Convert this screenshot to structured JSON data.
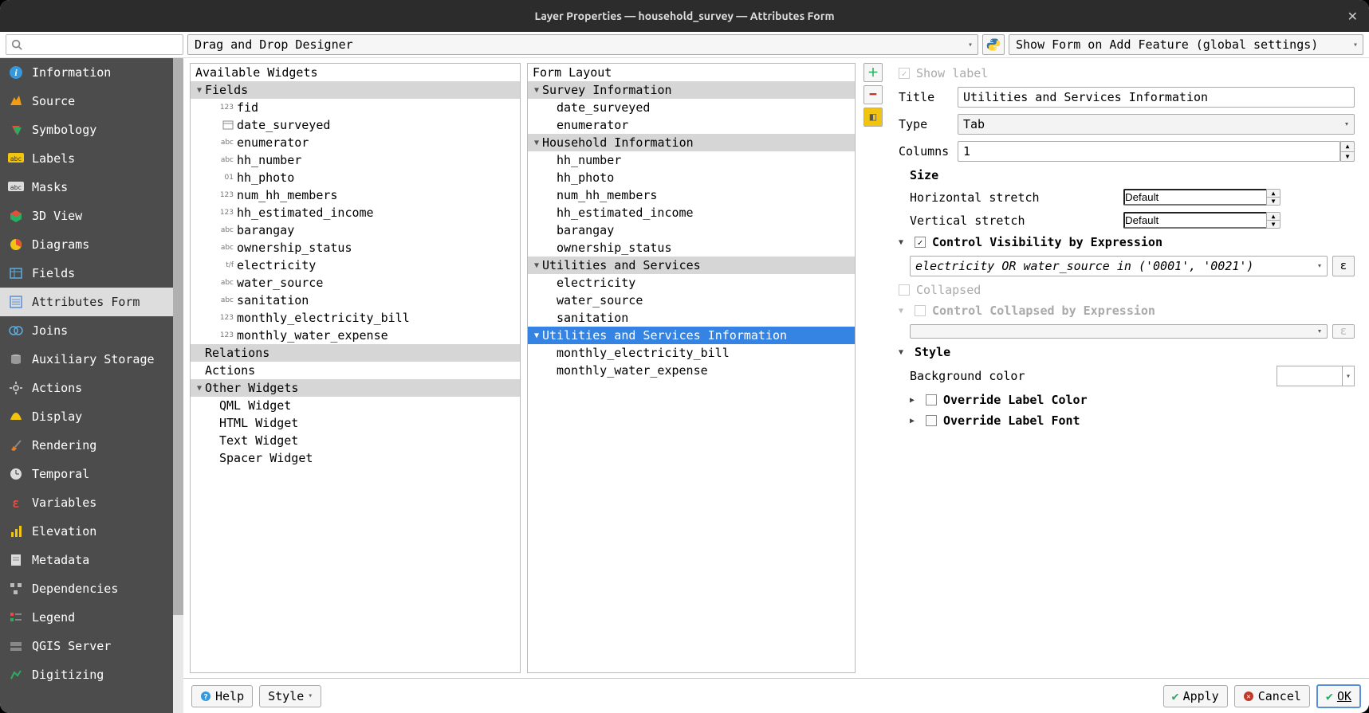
{
  "window": {
    "title": "Layer Properties — household_survey — Attributes Form"
  },
  "topbar": {
    "designer": "Drag and Drop Designer",
    "show_form": "Show Form on Add Feature (global settings)"
  },
  "sidebar": {
    "items": [
      {
        "label": "Information"
      },
      {
        "label": "Source"
      },
      {
        "label": "Symbology"
      },
      {
        "label": "Labels"
      },
      {
        "label": "Masks"
      },
      {
        "label": "3D View"
      },
      {
        "label": "Diagrams"
      },
      {
        "label": "Fields"
      },
      {
        "label": "Attributes Form"
      },
      {
        "label": "Joins"
      },
      {
        "label": "Auxiliary Storage"
      },
      {
        "label": "Actions"
      },
      {
        "label": "Display"
      },
      {
        "label": "Rendering"
      },
      {
        "label": "Temporal"
      },
      {
        "label": "Variables"
      },
      {
        "label": "Elevation"
      },
      {
        "label": "Metadata"
      },
      {
        "label": "Dependencies"
      },
      {
        "label": "Legend"
      },
      {
        "label": "QGIS Server"
      },
      {
        "label": "Digitizing"
      }
    ]
  },
  "available": {
    "header": "Available Widgets",
    "fields_group": "Fields",
    "fields": [
      {
        "icon": "123",
        "name": "fid"
      },
      {
        "icon": "date",
        "name": "date_surveyed"
      },
      {
        "icon": "abc",
        "name": "enumerator"
      },
      {
        "icon": "abc",
        "name": "hh_number"
      },
      {
        "icon": "01",
        "name": "hh_photo"
      },
      {
        "icon": "123",
        "name": "num_hh_members"
      },
      {
        "icon": "123",
        "name": "hh_estimated_income"
      },
      {
        "icon": "abc",
        "name": "barangay"
      },
      {
        "icon": "abc",
        "name": "ownership_status"
      },
      {
        "icon": "t/f",
        "name": "electricity"
      },
      {
        "icon": "abc",
        "name": "water_source"
      },
      {
        "icon": "abc",
        "name": "sanitation"
      },
      {
        "icon": "123",
        "name": "monthly_electricity_bill"
      },
      {
        "icon": "123",
        "name": "monthly_water_expense"
      }
    ],
    "relations_group": "Relations",
    "actions_group": "Actions",
    "other_group": "Other Widgets",
    "other": [
      "QML Widget",
      "HTML Widget",
      "Text Widget",
      "Spacer Widget"
    ]
  },
  "layout": {
    "header": "Form Layout",
    "groups": [
      {
        "name": "Survey Information",
        "children": [
          "date_surveyed",
          "enumerator"
        ]
      },
      {
        "name": "Household Information",
        "children": [
          "hh_number",
          "hh_photo",
          "num_hh_members",
          "hh_estimated_income",
          "barangay",
          "ownership_status"
        ]
      },
      {
        "name": "Utilities and Services",
        "children": [
          "electricity",
          "water_source",
          "sanitation"
        ]
      },
      {
        "name": "Utilities and Services Information",
        "selected": true,
        "children": [
          "monthly_electricity_bill",
          "monthly_water_expense"
        ]
      }
    ]
  },
  "props": {
    "show_label": "Show label",
    "title_label": "Title",
    "title_value": "Utilities and Services Information",
    "type_label": "Type",
    "type_value": "Tab",
    "columns_label": "Columns",
    "columns_value": "1",
    "size_header": "Size",
    "h_stretch_label": "Horizontal stretch",
    "h_stretch_value": "Default",
    "v_stretch_label": "Vertical stretch",
    "v_stretch_value": "Default",
    "ctrl_vis_label": "Control Visibility by Expression",
    "expr_value": "electricity OR water_source in ('0001', '0021')",
    "collapsed_label": "Collapsed",
    "ctrl_collapse_label": "Control Collapsed by Expression",
    "style_header": "Style",
    "bg_color_label": "Background color",
    "override_color": "Override Label Color",
    "override_font": "Override Label Font"
  },
  "footer": {
    "help": "Help",
    "style": "Style",
    "apply": "Apply",
    "cancel": "Cancel",
    "ok": "OK"
  }
}
